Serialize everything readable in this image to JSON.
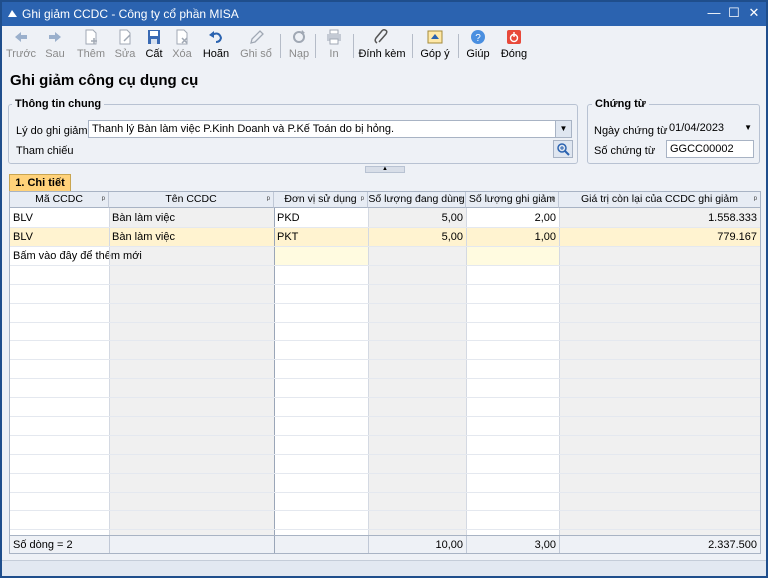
{
  "window": {
    "title": "Ghi giảm CCDC - Công ty cổ phần MISA",
    "minimize": "—",
    "restore": "☐",
    "close": "✕"
  },
  "toolbar": {
    "prev": "Trước",
    "next": "Sau",
    "add": "Thêm",
    "edit": "Sửa",
    "save": "Cất",
    "delete": "Xóa",
    "undo": "Hoãn",
    "post": "Ghi sổ",
    "reload": "Nạp",
    "print": "In",
    "attach": "Đính kèm",
    "feedback": "Góp ý",
    "help": "Giúp",
    "close": "Đóng"
  },
  "page_title": "Ghi giảm công cụ dụng cụ",
  "general": {
    "legend": "Thông tin chung",
    "reason_label": "Lý do ghi giảm",
    "reason_value": "Thanh lý Bàn làm việc P.Kinh Doanh và P.Kế Toán do bị hỏng.",
    "reference_label": "Tham chiếu"
  },
  "voucher": {
    "legend": "Chứng từ",
    "date_label": "Ngày chứng từ",
    "date_value": "01/04/2023",
    "number_label": "Số chứng từ",
    "number_value": "GGCC00002"
  },
  "tab": {
    "label": "1. Chi tiết"
  },
  "grid": {
    "columns": [
      "Mã CCDC",
      "Tên CCDC",
      "Đơn vị sử dụng",
      "Số lượng đang dùng",
      "Số lượng ghi giảm",
      "Giá trị còn lại của CCDC ghi giảm"
    ],
    "rows": [
      {
        "code": "BLV",
        "name": "Bàn làm việc",
        "unit": "PKD",
        "qty_in_use": "5,00",
        "qty_decrease": "2,00",
        "remaining_value": "1.558.333"
      },
      {
        "code": "BLV",
        "name": "Bàn làm việc",
        "unit": "PKT",
        "qty_in_use": "5,00",
        "qty_decrease": "1,00",
        "remaining_value": "779.167"
      }
    ],
    "add_hint": "Bấm vào đây để thêm mới",
    "footer": {
      "row_count": "Số dòng = 2",
      "total_in_use": "10,00",
      "total_decrease": "3,00",
      "total_value": "2.337.500"
    }
  },
  "colors": {
    "title_bar": "#2b63b0",
    "tab": "#ffd27a",
    "selected_row": "#fff3d0",
    "new_row": "#fffbe0"
  }
}
